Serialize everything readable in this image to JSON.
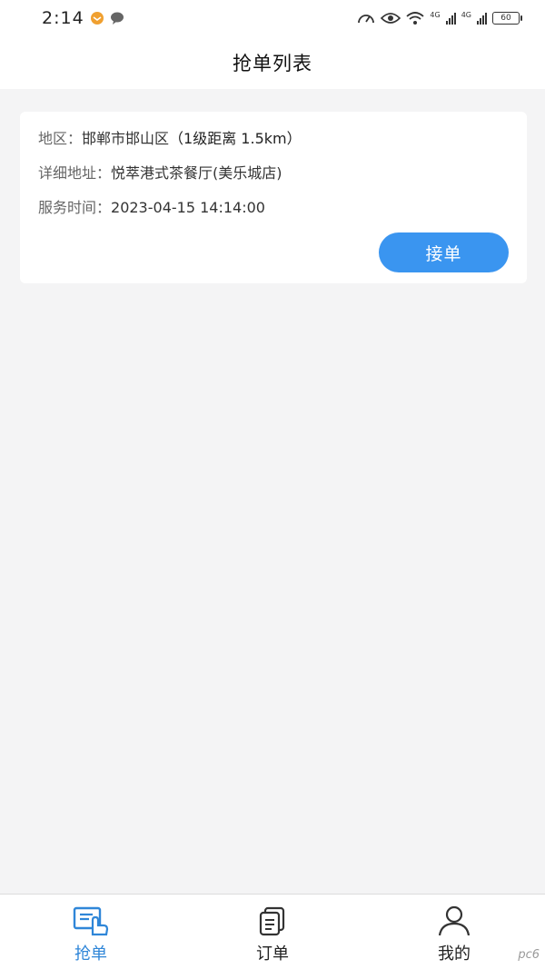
{
  "status_bar": {
    "time": "2:14",
    "network_1": "4G",
    "network_2": "4G",
    "battery": "60"
  },
  "header": {
    "title": "抢单列表"
  },
  "order": {
    "region_label": "地区：",
    "region_value": "邯郸市邯山区",
    "distance": "（1级距离 1.5km）",
    "address_label": "详细地址：",
    "address_value": "悦萃港式茶餐厅(美乐城店)",
    "time_label": "服务时间：",
    "time_value": "2023-04-15 14:14:00",
    "accept_label": "接单"
  },
  "tabbar": {
    "items": [
      {
        "label": "抢单",
        "icon": "grab-order-icon",
        "active": true
      },
      {
        "label": "订单",
        "icon": "order-list-icon",
        "active": false
      },
      {
        "label": "我的",
        "icon": "profile-icon",
        "active": false
      }
    ]
  },
  "colors": {
    "accent": "#3a95f0",
    "tab_active": "#2f86d8",
    "background": "#f4f4f5"
  },
  "watermark": "pc6"
}
